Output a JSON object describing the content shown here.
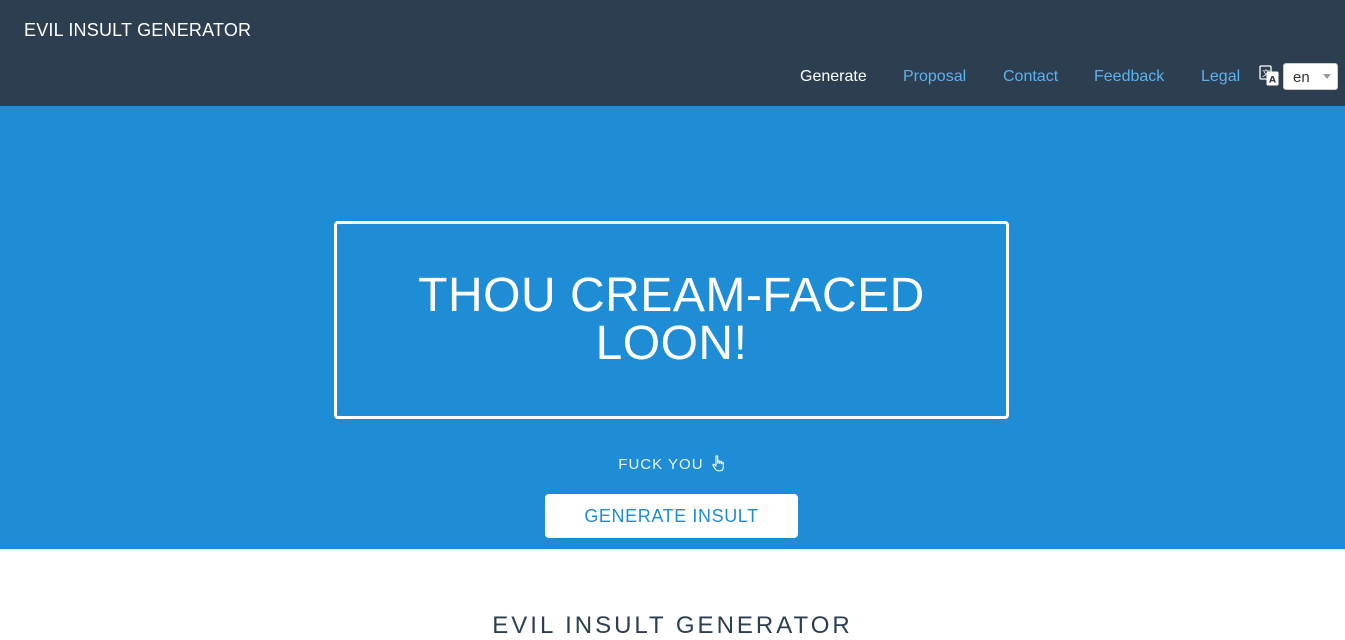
{
  "navbar": {
    "brand": "EVIL INSULT GENERATOR",
    "links": [
      {
        "label": "Generate",
        "active": true
      },
      {
        "label": "Proposal",
        "active": false
      },
      {
        "label": "Contact",
        "active": false
      },
      {
        "label": "Feedback",
        "active": false
      },
      {
        "label": "Legal",
        "active": false
      }
    ],
    "language_icon": "translate-icon",
    "language_selected": "en"
  },
  "hero": {
    "insult": "THOU CREAM-FACED LOON!",
    "fuck_you_label": "FUCK YOU",
    "fuck_you_icon": "pointing-hand-icon",
    "generate_button": "GENERATE INSULT"
  },
  "section": {
    "title": "EVIL INSULT GENERATOR"
  },
  "colors": {
    "navbar_bg": "#2c3e50",
    "hero_bg": "#1f8dd6",
    "link": "#5bb3f0",
    "active_link": "#ffffff"
  }
}
